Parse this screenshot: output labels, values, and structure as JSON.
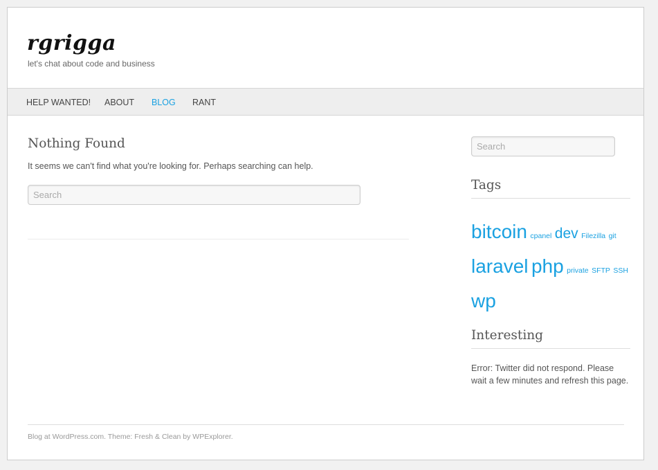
{
  "site": {
    "title": "rgrigga",
    "tagline": "let's chat about code and business"
  },
  "nav": {
    "items": [
      {
        "label": "HELP WANTED!",
        "active": false
      },
      {
        "label": "ABOUT",
        "active": false
      },
      {
        "label": "BLOG",
        "active": true
      },
      {
        "label": "RANT",
        "active": false
      }
    ],
    "active_color": "#1aa1e1"
  },
  "main": {
    "title": "Nothing Found",
    "text": "It seems we can't find what you're looking for. Perhaps searching can help.",
    "search_placeholder": "Search"
  },
  "sidebar": {
    "search_placeholder": "Search",
    "tags_title": "Tags",
    "tags": [
      {
        "label": "bitcoin",
        "size": "xl"
      },
      {
        "label": "cpanel",
        "size": "sm"
      },
      {
        "label": "dev",
        "size": "lg"
      },
      {
        "label": "Filezilla",
        "size": "sm"
      },
      {
        "label": "git",
        "size": "sm"
      },
      {
        "label": "laravel",
        "size": "xl"
      },
      {
        "label": "php",
        "size": "xl"
      },
      {
        "label": "private",
        "size": "sm"
      },
      {
        "label": "SFTP",
        "size": "sm"
      },
      {
        "label": "SSH",
        "size": "sm"
      },
      {
        "label": "wp",
        "size": "xl"
      }
    ],
    "tag_color": "#1aa1e1",
    "interesting_title": "Interesting",
    "twitter_error": "Error: Twitter did not respond. Please wait a few minutes and refresh this page."
  },
  "footer": {
    "blog_link": "Blog at WordPress.com.",
    "theme_text": "Theme: Fresh & Clean by WPExplorer."
  }
}
